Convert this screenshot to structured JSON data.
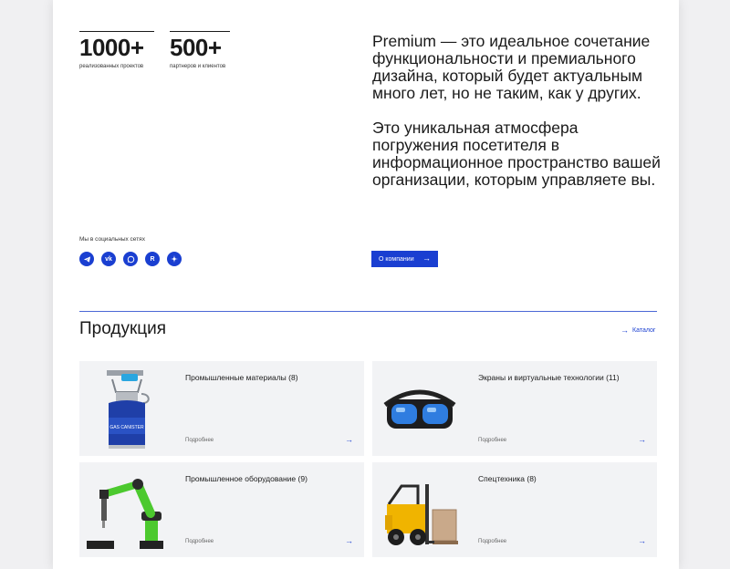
{
  "stats": [
    {
      "value": "1000+",
      "label": "реализованных проектов"
    },
    {
      "value": "500+",
      "label": "партнеров и клиентов"
    }
  ],
  "intro": {
    "p1": "Premium — это идеальное сочетание функциональности и премиального дизайна, который будет актуальным много лет, но не таким, как у других.",
    "p2": "Это уникальная атмосфера погружения посетителя в информационное пространство вашей организации, которым управляете вы."
  },
  "social": {
    "label": "Мы в социальных сетях",
    "icons": [
      "telegram-icon",
      "vk-icon",
      "whatsapp-icon",
      "rutube-icon",
      "yandex-zen-icon"
    ]
  },
  "about_button": "О компании",
  "products": {
    "title": "Продукция",
    "catalog_link": "Каталог",
    "items": [
      {
        "title": "Промышленные материалы (8)",
        "more": "Подробнее"
      },
      {
        "title": "Экраны и виртуальные технологии (11)",
        "more": "Подробнее"
      },
      {
        "title": "Промышленное оборудование (9)",
        "more": "Подробнее"
      },
      {
        "title": "Спецтехника (8)",
        "more": "Подробнее"
      }
    ]
  },
  "colors": {
    "accent": "#1a3fd1",
    "card_bg": "#f2f3f5",
    "page_bg": "#ffffff"
  }
}
